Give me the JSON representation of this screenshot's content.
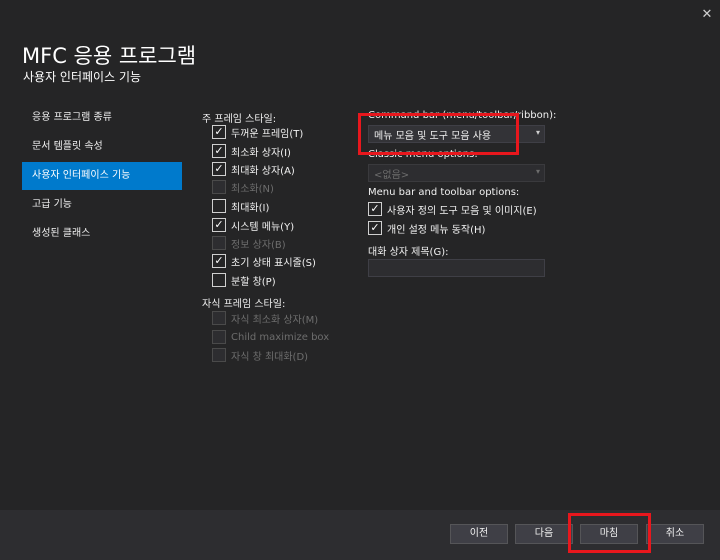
{
  "window": {
    "close_glyph": "✕"
  },
  "header": {
    "title": "MFC 응용 프로그램",
    "subtitle": "사용자 인터페이스 기능"
  },
  "sidebar": {
    "items": [
      {
        "label": "응용 프로그램 종류",
        "active": false
      },
      {
        "label": "문서 템플릿 속성",
        "active": false
      },
      {
        "label": "사용자 인터페이스 기능",
        "active": true
      },
      {
        "label": "고급 기능",
        "active": false
      },
      {
        "label": "생성된 클래스",
        "active": false
      }
    ]
  },
  "main_frame": {
    "label": "주 프레임 스타일:",
    "options": [
      {
        "label": "두꺼운 프레임(T)",
        "checked": true,
        "enabled": true
      },
      {
        "label": "최소화 상자(I)",
        "checked": true,
        "enabled": true
      },
      {
        "label": "최대화 상자(A)",
        "checked": true,
        "enabled": true
      },
      {
        "label": "최소화(N)",
        "checked": false,
        "enabled": false
      },
      {
        "label": "최대화(I)",
        "checked": false,
        "enabled": true
      },
      {
        "label": "시스템 메뉴(Y)",
        "checked": true,
        "enabled": true
      },
      {
        "label": "정보 상자(B)",
        "checked": false,
        "enabled": false
      },
      {
        "label": "초기 상태 표시줄(S)",
        "checked": true,
        "enabled": true
      },
      {
        "label": "분할 창(P)",
        "checked": false,
        "enabled": true
      }
    ]
  },
  "child_frame": {
    "label": "자식 프레임 스타일:",
    "options": [
      {
        "label": "자식 최소화 상자(M)",
        "checked": false,
        "enabled": false
      },
      {
        "label": "Child maximize box",
        "checked": false,
        "enabled": false
      },
      {
        "label": "자식 창 최대화(D)",
        "checked": false,
        "enabled": false
      }
    ]
  },
  "command_bar": {
    "label": "Command bar (menu/toolbar/ribbon):",
    "value": "메뉴 모음 및 도구 모음 사용"
  },
  "classic_menu": {
    "label": "Classic menu options:",
    "value": "<없음>"
  },
  "menu_toolbar": {
    "label": "Menu bar and toolbar options:",
    "options": [
      {
        "label": "사용자 정의 도구 모음 및 이미지(E)",
        "checked": true
      },
      {
        "label": "개인 설정 메뉴 동작(H)",
        "checked": true
      }
    ]
  },
  "dialog_caption": {
    "label": "대화 상자 제목(G):",
    "value": ""
  },
  "footer": {
    "prev_label": "이전",
    "next_label": "다음",
    "finish_label": "마침",
    "cancel_label": "취소"
  },
  "colors": {
    "background": "#252526",
    "accent": "#007acc",
    "highlight": "#e8171d"
  },
  "glyphs": {
    "check": "✓",
    "dropdown": "▾"
  }
}
